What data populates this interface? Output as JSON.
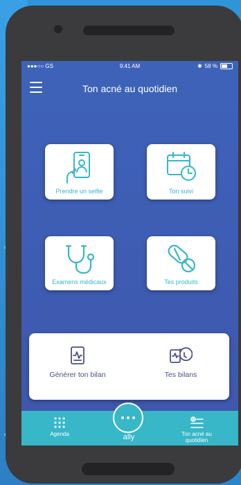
{
  "status_bar": {
    "carrier": "●●●○○ GS",
    "time": "9:41 AM",
    "battery": "58 %"
  },
  "header": {
    "title": "Ton acné au quotidien"
  },
  "cards": [
    {
      "label": "Prendre un selfie",
      "icon": "selfie-phone-icon"
    },
    {
      "label": "Ton suivi",
      "icon": "calendar-clock-icon"
    },
    {
      "label": "Examens médicaux",
      "icon": "stethoscope-icon"
    },
    {
      "label": "Tes produits",
      "icon": "pills-icon"
    }
  ],
  "bilan": {
    "generate_label": "Générer ton bilan",
    "history_label": "Tes bilans"
  },
  "tabbar": {
    "agenda_label": "Agenda",
    "center_label": "ally",
    "right_label_line1": "Ton acné au",
    "right_label_line2": "quotidien"
  },
  "colors": {
    "accent": "#37b7c8",
    "screen_bg": "#3d5db4",
    "card_text": "#35b7c9",
    "bilan_text": "#4a4f8e"
  }
}
